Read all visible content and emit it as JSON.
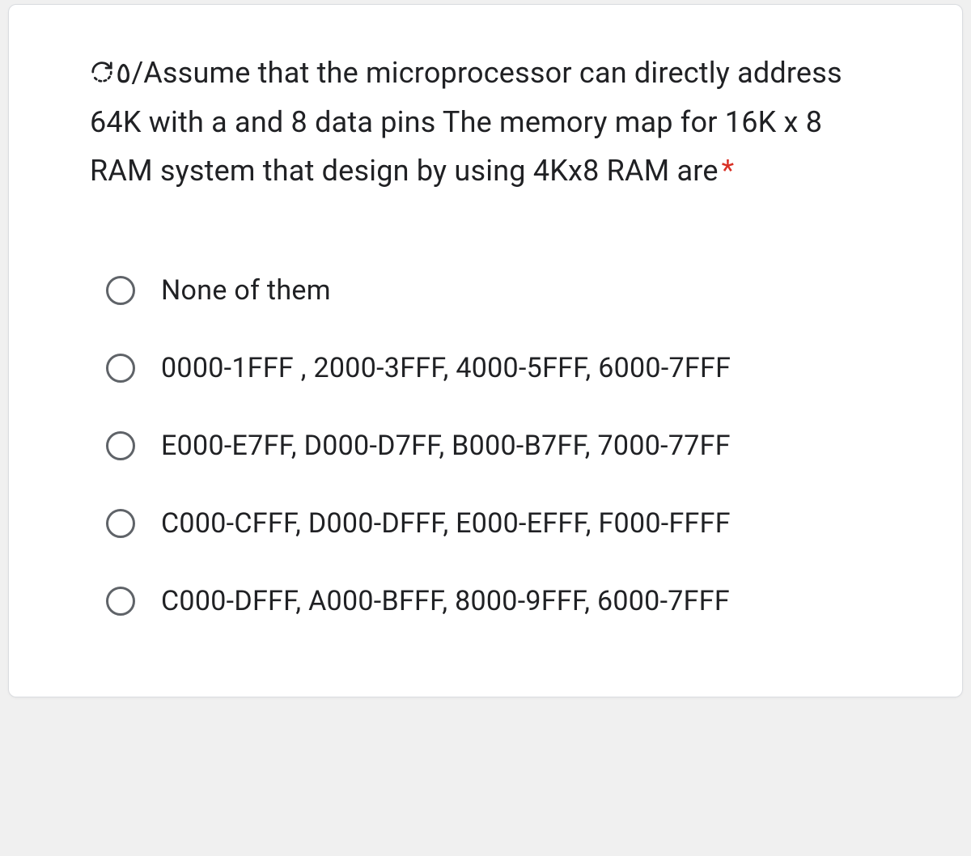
{
  "question": {
    "prefix_icon": "refresh",
    "prefix_text": "٥/",
    "text": "Assume that the microprocessor can directly address 64K with a and 8 data pins The memory map for 16K x 8 RAM system that design by using 4Kx8 RAM are",
    "required_mark": "*"
  },
  "options": [
    {
      "label": "None of them"
    },
    {
      "label": "0000-1FFF , 2000-3FFF, 4000-5FFF, 6000-7FFF"
    },
    {
      "label": "E000-E7FF, D000-D7FF, B000-B7FF, 7000-77FF"
    },
    {
      "label": "C000-CFFF, D000-DFFF, E000-EFFF, F000-FFFF"
    },
    {
      "label": "C000-DFFF, A000-BFFF, 8000-9FFF, 6000-7FFF"
    }
  ]
}
